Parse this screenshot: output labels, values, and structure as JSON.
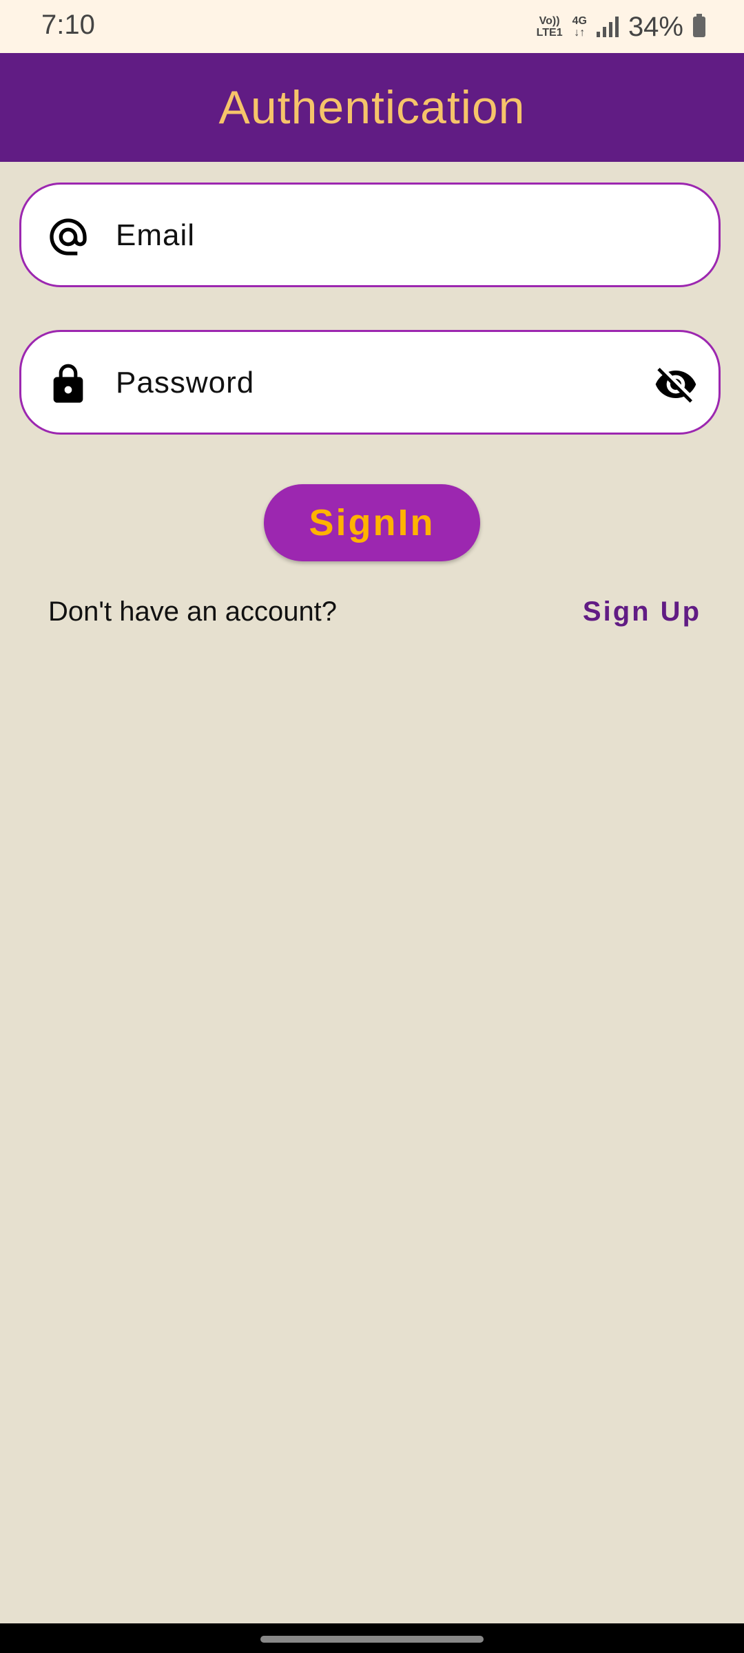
{
  "status_bar": {
    "time": "7:10",
    "volte_top": "Vo))",
    "volte_bottom": "LTE1",
    "network_top": "4G",
    "network_bottom": "↓↑",
    "battery": "34%"
  },
  "app_bar": {
    "title": "Authentication"
  },
  "email_field": {
    "placeholder": "Email",
    "value": "",
    "icon": "at-sign-icon"
  },
  "password_field": {
    "placeholder": "Password",
    "value": "",
    "icon": "lock-icon",
    "toggle_icon": "eye-off-icon"
  },
  "signin_button": {
    "label": "SignIn"
  },
  "signup_prompt": {
    "text": "Don't have an account?",
    "link": "Sign Up"
  },
  "colors": {
    "app_bar": "#611c84",
    "title": "#f6c46a",
    "accent": "#9c27b0",
    "button_text": "#ffb300",
    "background": "#e6e0cf"
  }
}
